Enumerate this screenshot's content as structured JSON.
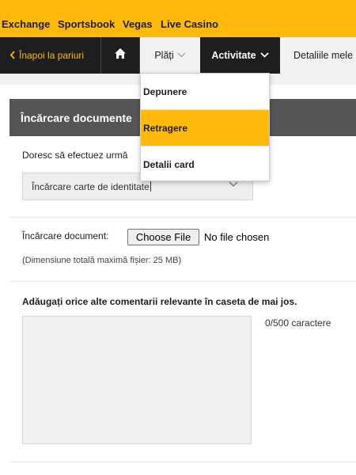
{
  "topnav": {
    "items": [
      "Exchange",
      "Sportsbook",
      "Vegas",
      "Live Casino"
    ]
  },
  "subnav": {
    "back_label": "Înapoi la pariuri",
    "home_icon": "home-icon",
    "plati_label": "Plăți",
    "activitate_label": "Activitate",
    "detalii_label": "Detaliile mele"
  },
  "dropdown": {
    "items": [
      {
        "label": "Depunere",
        "active": false
      },
      {
        "label": "Retragere",
        "active": true
      },
      {
        "label": "Detalii card",
        "active": false
      }
    ]
  },
  "section": {
    "title": "Încărcare documente"
  },
  "form": {
    "question": "Doresc să efectuez urmă",
    "select_value": "Încărcare carte de identitate",
    "upload_label": "Încărcare document:",
    "file_button": "Choose File",
    "file_status": "No file chosen",
    "size_hint": "(Dimensiune totală maximă fișier: 25 MB)",
    "comment_label": "Adăugați orice alte comentarii relevante în caseta de mai jos.",
    "char_count": "0/500 caractere"
  },
  "colors": {
    "accent": "#ffb80c",
    "dark": "#1e1e1e",
    "header": "#555555"
  }
}
